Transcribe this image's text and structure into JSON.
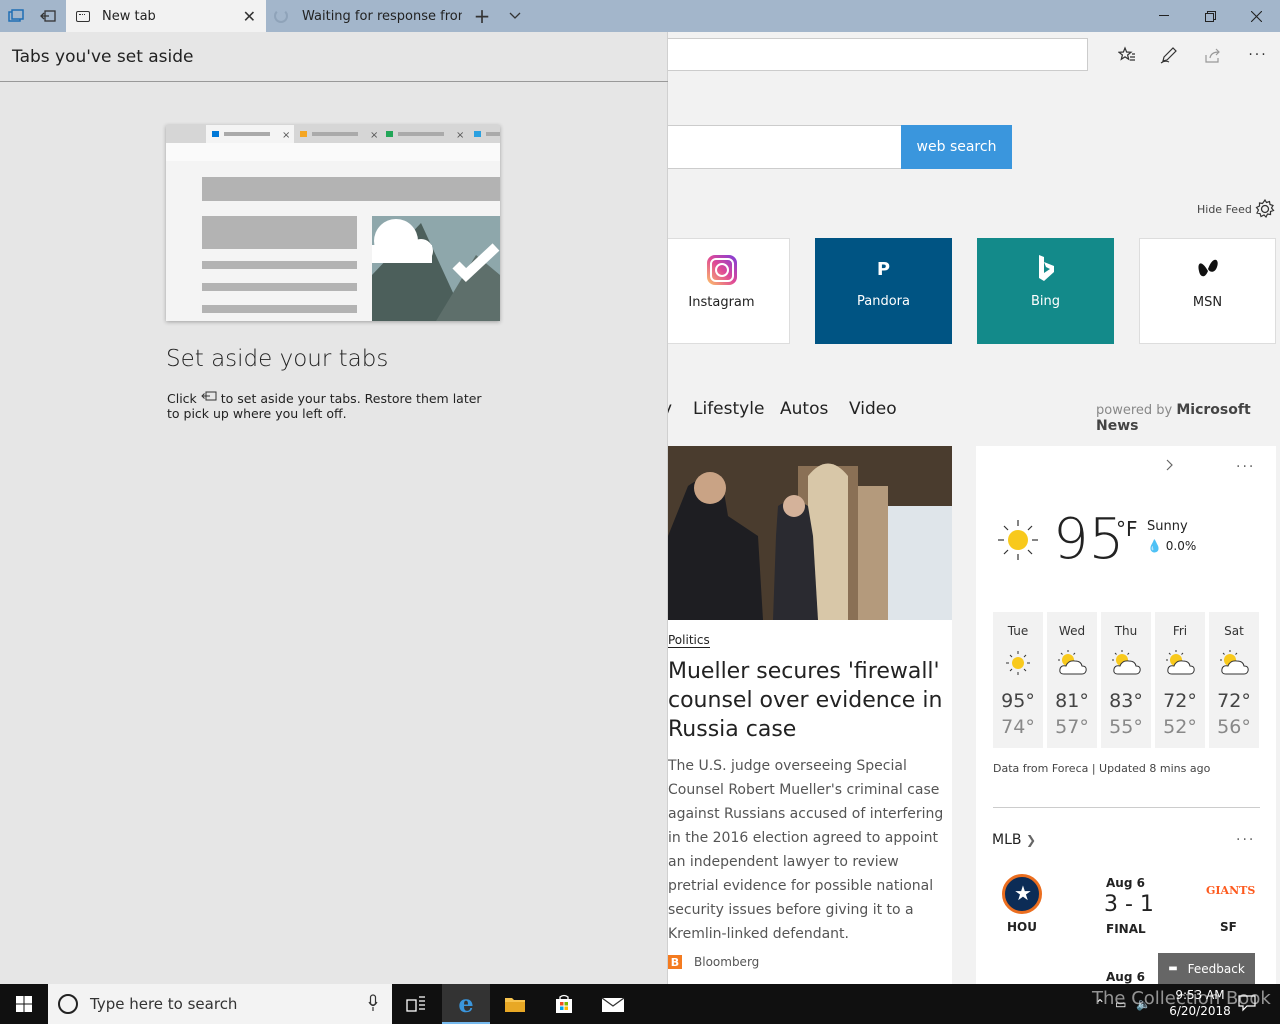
{
  "titlebar": {
    "tabs": [
      {
        "label": "New tab"
      },
      {
        "label": "Waiting for response from S"
      }
    ]
  },
  "panel": {
    "title": "Tabs you've set aside",
    "heading": "Set aside your tabs",
    "body_before": "Click",
    "body_after": "to set aside your tabs. Restore them later to pick up where you left off."
  },
  "page": {
    "search_button": "web search",
    "hide_feed": "Hide Feed",
    "tiles": [
      {
        "label": "Instagram",
        "bg": "#ffffff",
        "color": "#222222"
      },
      {
        "label": "Pandora",
        "bg": "#005483",
        "color": "#ffffff",
        "glyph": "P"
      },
      {
        "label": "Bing",
        "bg": "#138a8a",
        "color": "#ffffff",
        "glyph": "b"
      },
      {
        "label": "MSN",
        "bg": "#ffffff",
        "color": "#222222",
        "glyph": "✦"
      }
    ],
    "news_nav": [
      "y",
      "Lifestyle",
      "Autos",
      "Video"
    ],
    "powered_prefix": "powered by",
    "powered_brand": "Microsoft News"
  },
  "article": {
    "category": "Politics",
    "title": "Mueller secures 'firewall' counsel over evidence in Russia case",
    "body": "The U.S. judge overseeing Special Counsel Robert Mueller's criminal case against Russians accused of interfering in the 2016 election agreed to appoint an independent lawyer to review pretrial evidence for possible national security issues before giving it to a Kremlin-linked defendant.",
    "source": "Bloomberg"
  },
  "weather": {
    "temp": "95",
    "unit": "°F",
    "condition": "Sunny",
    "precip": "0.0%",
    "forecast": [
      {
        "day": "Tue",
        "hi": "95°",
        "lo": "74°",
        "icon": "sun-icon"
      },
      {
        "day": "Wed",
        "hi": "81°",
        "lo": "57°",
        "icon": "partly-cloudy-icon"
      },
      {
        "day": "Thu",
        "hi": "83°",
        "lo": "55°",
        "icon": "partly-cloudy-icon"
      },
      {
        "day": "Fri",
        "hi": "72°",
        "lo": "52°",
        "icon": "partly-cloudy-icon"
      },
      {
        "day": "Sat",
        "hi": "72°",
        "lo": "56°",
        "icon": "partly-cloudy-icon"
      }
    ],
    "source": "Data from Foreca | Updated 8 mins ago"
  },
  "mlb": {
    "title": "MLB",
    "game1": {
      "date": "Aug 6",
      "score": "3 - 1",
      "status": "FINAL",
      "home": "HOU",
      "away": "SF"
    },
    "game2_date": "Aug 6"
  },
  "feedback": "Feedback",
  "taskbar": {
    "search_placeholder": "Type here to search",
    "time": "9:53 AM",
    "date": "6/20/2018"
  },
  "watermark": "The Collection Book"
}
